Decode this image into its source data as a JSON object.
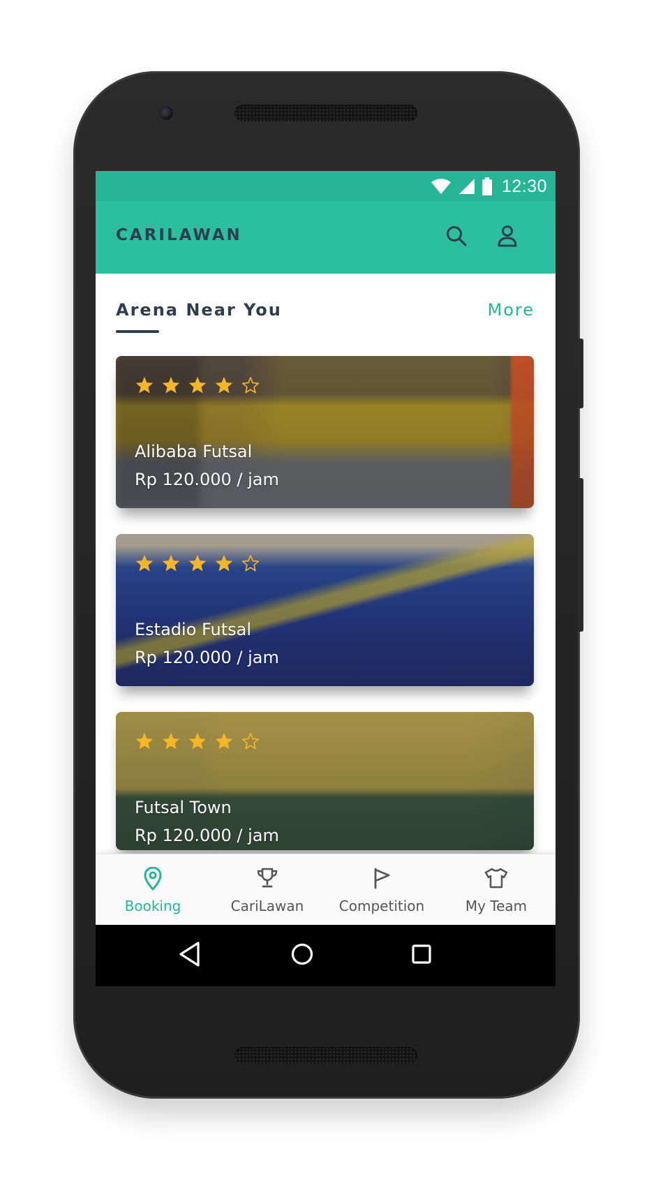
{
  "status_bar": {
    "time": "12:30",
    "icons": [
      "wifi-icon",
      "signal-icon",
      "battery-icon"
    ]
  },
  "app_bar": {
    "title": "CARILAWAN",
    "actions": [
      "search-icon",
      "profile-icon"
    ]
  },
  "section": {
    "title": "Arena Near You",
    "more_label": "More"
  },
  "arenas": [
    {
      "name": "Alibaba Futsal",
      "price": "Rp 120.000 / jam",
      "rating": 4,
      "max_rating": 5
    },
    {
      "name": "Estadio Futsal",
      "price": "Rp 120.000 / jam",
      "rating": 4,
      "max_rating": 5
    },
    {
      "name": "Futsal Town",
      "price": "Rp 120.000 / jam",
      "rating": 4,
      "max_rating": 5
    }
  ],
  "bottom_nav": [
    {
      "label": "Booking",
      "icon": "location-pin-icon",
      "active": true
    },
    {
      "label": "CariLawan",
      "icon": "trophy-icon",
      "active": false
    },
    {
      "label": "Competition",
      "icon": "flag-icon",
      "active": false
    },
    {
      "label": "My Team",
      "icon": "jersey-icon",
      "active": false
    }
  ],
  "system_nav": [
    "back-icon",
    "home-icon",
    "recents-icon"
  ],
  "colors": {
    "primary": "#2bbf9e",
    "status_bar": "#26b597",
    "accent": "#26b597",
    "title_text": "#2c3e50",
    "star": "#f7b529"
  }
}
